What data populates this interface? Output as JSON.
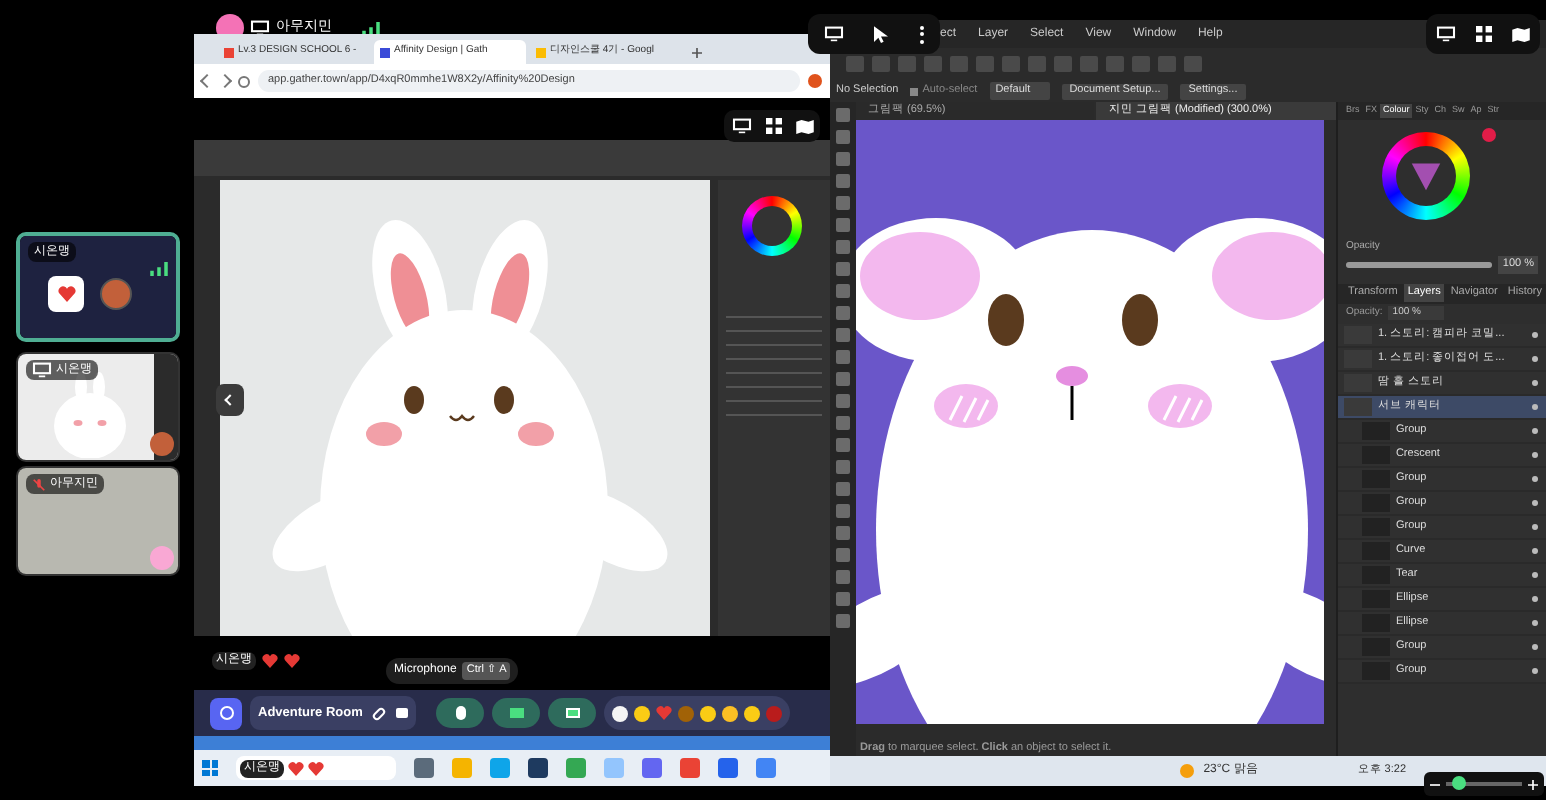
{
  "presenter_badge": {
    "name": "아무지민"
  },
  "browser": {
    "tabs": [
      {
        "label": "Lv.3 DESIGN SCHOOL 6 -",
        "selected": false
      },
      {
        "label": "Affinity Design | Gath",
        "selected": true
      },
      {
        "label": "디자인스쿨 4기 - Googl",
        "selected": false
      }
    ],
    "url": "app.gather.town/app/D4xqR0mmhe1W8X2y/Affinity%20Design"
  },
  "participants": [
    {
      "kind": "avatar",
      "name": "시온맹",
      "selected": true,
      "muted": false
    },
    {
      "kind": "screen",
      "name": "시온맹",
      "selected": false,
      "muted": false
    },
    {
      "kind": "video",
      "name": "아무지민",
      "selected": false,
      "muted": true
    }
  ],
  "chat_tag": {
    "name": "시온맹"
  },
  "tooltip": {
    "label": "Microphone",
    "shortcut": "Ctrl ⇧ A"
  },
  "toolbar": {
    "room": "Adventure Room"
  },
  "taskbar_tag": {
    "name": "시온맹"
  },
  "affinity": {
    "menu": [
      "ect",
      "Layer",
      "Select",
      "View",
      "Window",
      "Help"
    ],
    "context": {
      "selection": "No Selection",
      "auto_select": "Auto-select",
      "auto_select_checked": true,
      "mode": "Default",
      "buttons": [
        "Document Setup...",
        "Settings..."
      ]
    },
    "doc_tabs": [
      {
        "label": "그림팩 (69.5%)",
        "selected": false
      },
      {
        "label": "지민 그림팩 (Modified) (300.0%)",
        "selected": true
      }
    ],
    "studio_tabs": [
      {
        "label": "Brs",
        "selected": false
      },
      {
        "label": "FX",
        "selected": false
      },
      {
        "label": "Colour",
        "selected": true
      },
      {
        "label": "Sty",
        "selected": false
      },
      {
        "label": "Ch",
        "selected": false
      },
      {
        "label": "Sw",
        "selected": false
      },
      {
        "label": "Ap",
        "selected": false
      },
      {
        "label": "Str",
        "selected": false
      }
    ],
    "opacity_label": "Opacity",
    "opacity": "100 %",
    "opacity_slider": {
      "level": 1
    },
    "panel_tabs": [
      {
        "label": "Transform",
        "selected": false
      },
      {
        "label": "Layers",
        "selected": true
      },
      {
        "label": "Navigator",
        "selected": false
      },
      {
        "label": "History",
        "selected": false
      }
    ],
    "layer_opacity": "Opacity:",
    "layer_opacity_value": "100 %",
    "layers": [
      {
        "name": "1. 스토리: 캠피라 코밀...",
        "selected": false
      },
      {
        "name": "1. 스토리: 좋이접어 도...",
        "selected": false
      },
      {
        "name": "땀 흘 스토리",
        "selected": false
      },
      {
        "name": "서브 캐릭터",
        "selected": true,
        "children": [
          {
            "name": "Group",
            "selected": false
          },
          {
            "name": "Crescent",
            "selected": false
          },
          {
            "name": "Group",
            "selected": false
          },
          {
            "name": "Group",
            "selected": false
          },
          {
            "name": "Group",
            "selected": false
          },
          {
            "name": "Curve",
            "selected": false
          },
          {
            "name": "Tear",
            "selected": false
          },
          {
            "name": "Ellipse",
            "selected": false
          },
          {
            "name": "Ellipse",
            "selected": false
          },
          {
            "name": "Group",
            "selected": false
          },
          {
            "name": "Group",
            "selected": false
          }
        ]
      }
    ],
    "status": "**Drag** to marquee select. **Click** an object to select it."
  },
  "system_tray": {
    "weather": "23°C 맑음",
    "time": "오후 3:22"
  },
  "zoom_control": {
    "level": 0.15
  }
}
